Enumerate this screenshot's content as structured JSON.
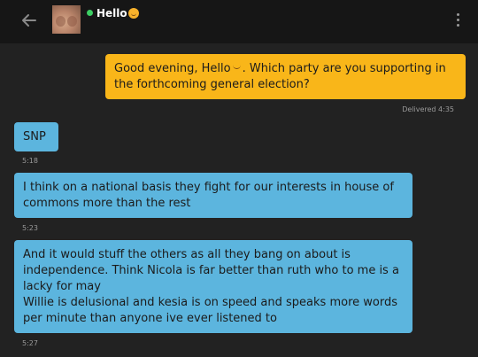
{
  "header": {
    "contact_name": "Hello",
    "name_emoji": "grinning-face-icon",
    "online": true,
    "colors": {
      "bar": "#161616",
      "online_dot": "#3ccf63"
    }
  },
  "messages": [
    {
      "direction": "outgoing",
      "text_before": "Good evening, Hello",
      "inline_emoji": "smile-icon",
      "text_after": ". Which party are you supporting in the forthcoming general election?",
      "status": "Delivered 4:35"
    },
    {
      "direction": "incoming",
      "text": "SNP",
      "time": "5:18"
    },
    {
      "direction": "incoming",
      "text": "I think on a national basis they fight for our interests in house of commons more than the rest",
      "time": "5:23"
    },
    {
      "direction": "incoming",
      "text_lines": [
        "And it would stuff the others as all they bang on about is independence.  Think Nicola is far better than ruth who to me is a lacky for may",
        "Willie is delusional and kesia is on speed and speaks more words per minute than anyone ive ever listened to"
      ],
      "time": "5:27"
    }
  ],
  "colors": {
    "background": "#222222",
    "outgoing_bubble": "#f9b619",
    "incoming_bubble": "#5cb5de",
    "meta_text": "#9a9a9a"
  }
}
